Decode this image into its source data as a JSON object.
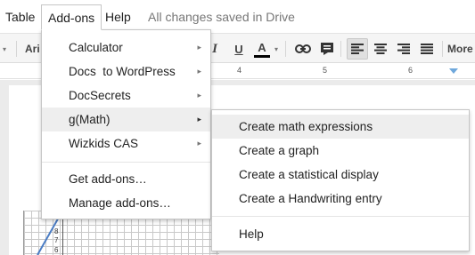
{
  "menubar": {
    "table": "Table",
    "addons": "Add-ons",
    "help": "Help",
    "status": "All changes saved in Drive"
  },
  "toolbar": {
    "font_fragment": "Ari",
    "italic": "I",
    "underline": "U",
    "text_color": "A",
    "more": "More",
    "caret": "▾"
  },
  "ruler": {
    "marks": [
      "4",
      "5",
      "6"
    ]
  },
  "addons_menu": {
    "items": [
      {
        "label": "Calculator",
        "submenu": true
      },
      {
        "label": "Docs  to WordPress",
        "submenu": true
      },
      {
        "label": "DocSecrets",
        "submenu": true
      },
      {
        "label": "g(Math)",
        "submenu": true,
        "highlighted": true
      },
      {
        "label": "Wizkids CAS",
        "submenu": true
      },
      {
        "label": "Get add-ons…",
        "submenu": false
      },
      {
        "label": "Manage add-ons…",
        "submenu": false
      }
    ],
    "arrow": "▸"
  },
  "gmath_menu": {
    "items": [
      {
        "label": "Create math expressions",
        "highlighted": true
      },
      {
        "label": "Create a graph"
      },
      {
        "label": "Create a statistical display"
      },
      {
        "label": "Create a Handwriting entry"
      },
      {
        "label": "Help"
      }
    ]
  },
  "graph": {
    "y_labels": [
      "8",
      "7",
      "6"
    ]
  },
  "icons": [
    "link-icon",
    "comment-icon",
    "align-left-icon",
    "align-center-icon",
    "align-right-icon",
    "align-justify-icon",
    "submenu-arrow-icon"
  ],
  "colors": {
    "highlight": "#eeeeee",
    "ruler_marker": "#6fa8dc",
    "status": "#777777"
  }
}
